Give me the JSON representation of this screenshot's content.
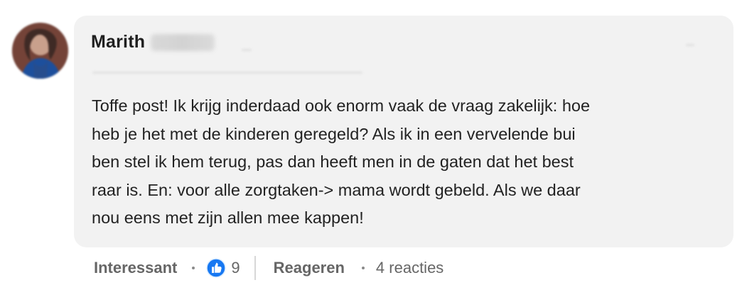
{
  "comment": {
    "author": {
      "name": "Marith",
      "avatar_icon": "profile-avatar"
    },
    "text": "Toffe post! Ik krijg inderdaad ook enorm vaak de vraag zakelijk: hoe\nheb je het met de kinderen geregeld? Als ik in een vervelende bui\nben stel ik hem terug, pas dan heeft men in de gaten dat het best\nraar is. En: voor alle zorgtaken-> mama wordt gebeld. Als we daar\nnou eens met zijn allen mee kappen!"
  },
  "actions": {
    "like_label": "Interessant",
    "reaction_icon": "thumbs-up-icon",
    "reaction_count": "9",
    "reply_label": "Reageren",
    "replies_label": "4 reacties"
  },
  "colors": {
    "bubble_background": "#f2f2f2",
    "text_primary": "#222222",
    "text_secondary": "#666666",
    "reaction_blue": "#1778f2"
  }
}
